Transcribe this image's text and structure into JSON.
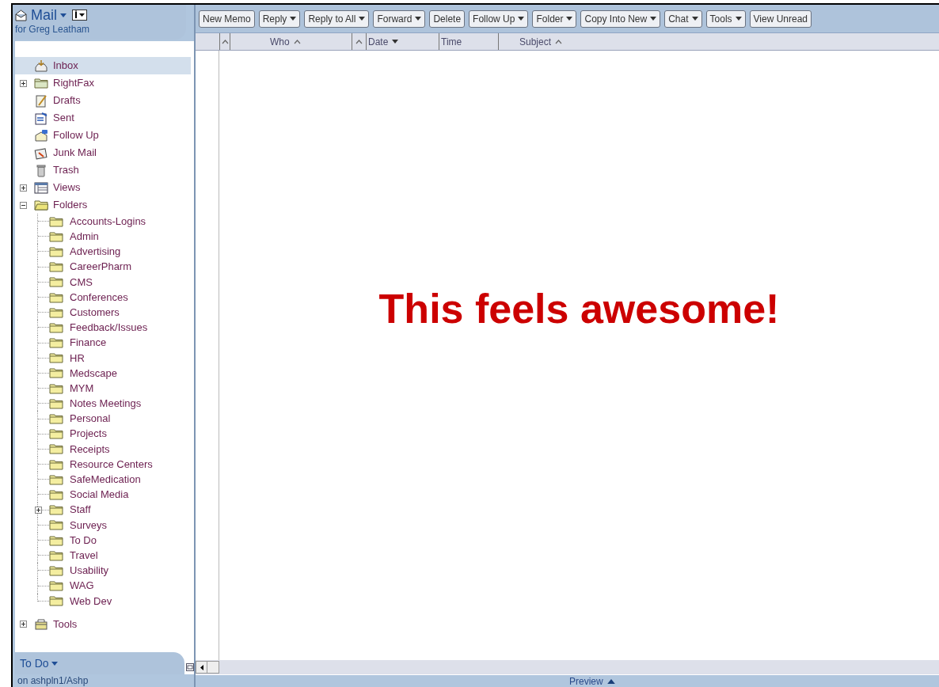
{
  "header": {
    "title": "Mail",
    "subtitle": "for Greg Leatham"
  },
  "nav": [
    {
      "label": "Inbox",
      "selected": true
    },
    {
      "label": "RightFax",
      "selected": false,
      "expanded": false
    },
    {
      "label": "Drafts",
      "selected": false
    },
    {
      "label": "Sent",
      "selected": false
    },
    {
      "label": "Follow Up",
      "selected": false
    },
    {
      "label": "Junk Mail",
      "selected": false
    },
    {
      "label": "Trash",
      "selected": false
    },
    {
      "label": "Views",
      "selected": false,
      "expanded": false
    },
    {
      "label": "Folders",
      "selected": false,
      "expanded": true,
      "children": [
        {
          "label": "Accounts-Logins",
          "selected": false
        },
        {
          "label": "Admin",
          "selected": false
        },
        {
          "label": "Advertising",
          "selected": false
        },
        {
          "label": "CareerPharm",
          "selected": false
        },
        {
          "label": "CMS",
          "selected": false
        },
        {
          "label": "Conferences",
          "selected": false
        },
        {
          "label": "Customers",
          "selected": false
        },
        {
          "label": "Feedback/Issues",
          "selected": false
        },
        {
          "label": "Finance",
          "selected": false
        },
        {
          "label": "HR",
          "selected": false
        },
        {
          "label": "Medscape",
          "selected": false
        },
        {
          "label": "MYM",
          "selected": false
        },
        {
          "label": "Notes Meetings",
          "selected": false
        },
        {
          "label": "Personal",
          "selected": false
        },
        {
          "label": "Projects",
          "selected": false
        },
        {
          "label": "Receipts",
          "selected": false
        },
        {
          "label": "Resource Centers",
          "selected": false
        },
        {
          "label": "SafeMedication",
          "selected": false
        },
        {
          "label": "Social Media",
          "selected": false
        },
        {
          "label": "Staff",
          "selected": false,
          "expanded": false
        },
        {
          "label": "Surveys",
          "selected": false
        },
        {
          "label": "To Do",
          "selected": false
        },
        {
          "label": "Travel",
          "selected": false
        },
        {
          "label": "Usability",
          "selected": false
        },
        {
          "label": "WAG",
          "selected": false
        },
        {
          "label": "Web Dev",
          "selected": false
        }
      ]
    },
    {
      "label": "Tools",
      "selected": false,
      "expanded": false
    }
  ],
  "todo": {
    "label": "To Do"
  },
  "server": "on ashpln1/Ashp",
  "toolbar": [
    {
      "label": "New Memo",
      "menu": false
    },
    {
      "label": "Reply",
      "menu": true
    },
    {
      "label": "Reply to All",
      "menu": true
    },
    {
      "label": "Forward",
      "menu": true
    },
    {
      "label": "Delete",
      "menu": false
    },
    {
      "label": "Follow Up",
      "menu": true
    },
    {
      "label": "Folder",
      "menu": true
    },
    {
      "label": "Copy Into New",
      "menu": true
    },
    {
      "label": "Chat",
      "menu": true
    },
    {
      "label": "Tools",
      "menu": true
    },
    {
      "label": "View Unread",
      "menu": false
    }
  ],
  "columns": [
    {
      "sortable": true,
      "descending": false
    },
    {
      "label": "Who",
      "sortable": true,
      "descending": false
    },
    {
      "sortable": true,
      "descending": false
    },
    {
      "label": "Date",
      "sortable": true,
      "descending": true
    },
    {
      "label": "Time",
      "sortable": false
    },
    {
      "label": "Subject",
      "sortable": true,
      "descending": false
    }
  ],
  "annotation": "This feels awesome!",
  "preview": {
    "label": "Preview"
  }
}
